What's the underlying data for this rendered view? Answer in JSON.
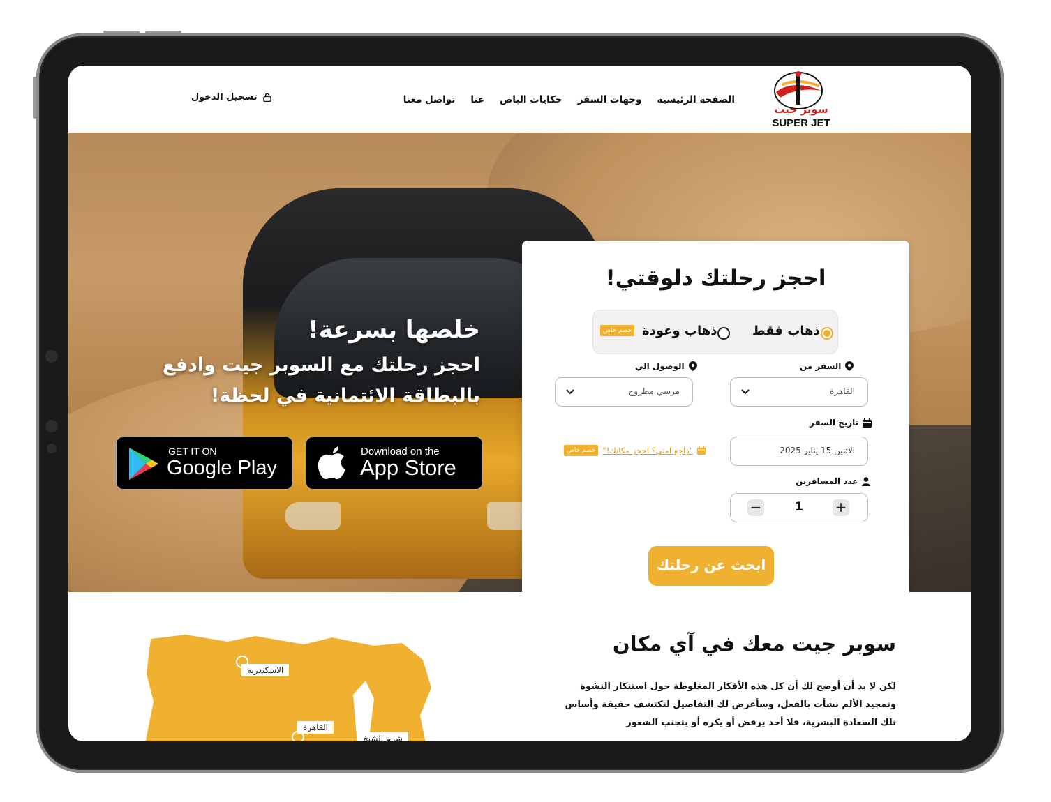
{
  "brand": {
    "name_en": "SUPER JET",
    "name_ar": "سوبر جيت",
    "accent_color": "#f0b030"
  },
  "nav": {
    "items": [
      "الصفحة الرئيسية",
      "وجهات السفر",
      "حكايات الباص",
      "عنا",
      "تواصل معنا"
    ],
    "login_label": "تسجيل الدخول",
    "login_icon": "lock-icon"
  },
  "hero": {
    "headline": "خلصها بسرعة!",
    "subheadline": "احجز رحلتك مع السوبر جيت وادفع بالبطاقة الائتمانية في لحظة!",
    "google_play": {
      "small": "GET IT ON",
      "big": "Google Play"
    },
    "app_store": {
      "small": "Download on the",
      "big": "App Store"
    }
  },
  "booking": {
    "title": "احجز رحلتك دلوقتي!",
    "trip_types": [
      {
        "label": "ذهاب فقط",
        "selected": true
      },
      {
        "label": "ذهاب وعودة",
        "selected": false,
        "badge": "خصم خاص"
      }
    ],
    "from": {
      "label": "السفر من",
      "value": "القاهرة",
      "icon": "location-pin-icon"
    },
    "to": {
      "label": "الوصول الي",
      "value": "مرسي مطروح",
      "icon": "location-pin-icon"
    },
    "date": {
      "label": "تاريخ السفر",
      "value": "الاثنين 15 يناير 2025",
      "icon": "calendar-icon"
    },
    "reminder": {
      "text": "\"راجع امتى؟ احجز مكانك!\"",
      "badge": "خصم خاص",
      "icon": "calendar-icon"
    },
    "passengers": {
      "label": "عدد المسافرين",
      "value": "1",
      "icon": "user-icon"
    },
    "search_label": "ابحث عن رحلتك"
  },
  "section": {
    "title": "سوبر جيت معك في آي مكان",
    "body": "لكن لا بد أن أوضح لك أن كل هذه الأفكار المغلوطة حول استنكار النشوة وتمجيد الألم نشأت بالفعل، وسأعرض لك التفاصيل لتكتشف حقيقة وأساس تلك السعادة البشرية، فلا أحد يرفض أو يكره أو يتجنب الشعور",
    "map_labels": [
      "الاسكندرية",
      "القاهرة",
      "شرم الشيخ"
    ]
  }
}
